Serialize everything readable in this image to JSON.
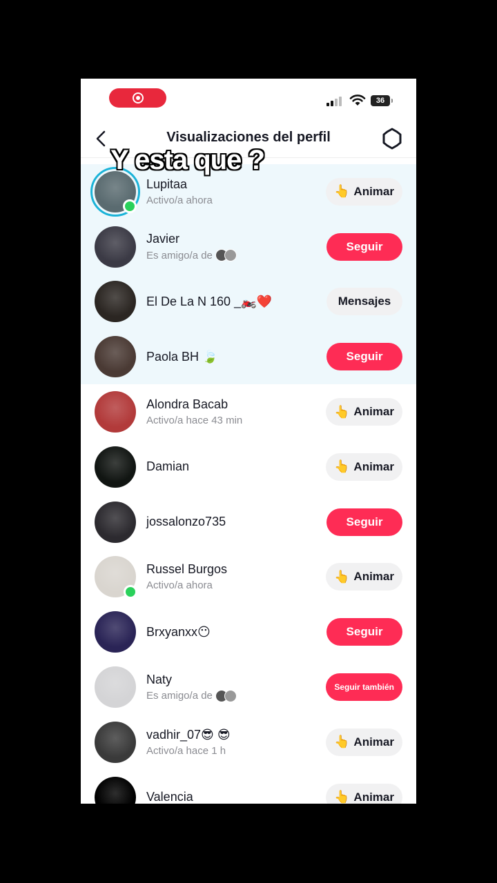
{
  "status_bar": {
    "battery": "36"
  },
  "header": {
    "title": "Visualizaciones del perfil"
  },
  "caption": "Y esta que ?",
  "rows": [
    {
      "name": "Lupitaa",
      "sub": "Activo/a ahora",
      "button": "Animar",
      "button_icon": "👆",
      "style": "gray",
      "highlight": true,
      "story": true,
      "online": true,
      "avatar_color": "#5a6b70"
    },
    {
      "name": "Javier",
      "sub": "Es amigo/a de",
      "button": "Seguir",
      "style": "red",
      "highlight": true,
      "mutuals": true,
      "avatar_color": "#3b3a45"
    },
    {
      "name": "El De La N 160 _🏍️❤️",
      "sub": "",
      "button": "Mensajes",
      "style": "gray",
      "highlight": true,
      "avatar_color": "#2b2622"
    },
    {
      "name": "Paola BH 🍃",
      "sub": "",
      "button": "Seguir",
      "style": "red",
      "highlight": true,
      "avatar_color": "#4a3a34"
    },
    {
      "name": "Alondra Bacab",
      "sub": "Activo/a hace 43 min",
      "button": "Animar",
      "button_icon": "👆",
      "style": "gray",
      "avatar_color": "#b23a3a"
    },
    {
      "name": "Damian",
      "sub": "",
      "button": "Animar",
      "button_icon": "👆",
      "style": "gray",
      "avatar_color": "#111512"
    },
    {
      "name": "jossalonzo735",
      "sub": "",
      "button": "Seguir",
      "style": "red",
      "avatar_color": "#2c2a2f"
    },
    {
      "name": "Russel Burgos",
      "sub": "Activo/a ahora",
      "button": "Animar",
      "button_icon": "👆",
      "style": "gray",
      "online": true,
      "avatar_color": "#d9d5cf"
    },
    {
      "name": "Brxyanxx😶",
      "sub": "",
      "button": "Seguir",
      "style": "red",
      "avatar_color": "#2a2456"
    },
    {
      "name": "Naty",
      "sub": "Es amigo/a de",
      "button": "Seguir también",
      "style": "red",
      "small": true,
      "mutuals": true,
      "avatar_color": "#d4d4d6"
    },
    {
      "name": "vadhir_07😎 😎",
      "sub": "Activo/a hace 1 h",
      "button": "Animar",
      "button_icon": "👆",
      "style": "gray",
      "avatar_color": "#3a3a3a"
    },
    {
      "name": "Valencia",
      "sub": "",
      "button": "Animar",
      "button_icon": "👆",
      "style": "gray",
      "avatar_color": "#000000"
    }
  ]
}
